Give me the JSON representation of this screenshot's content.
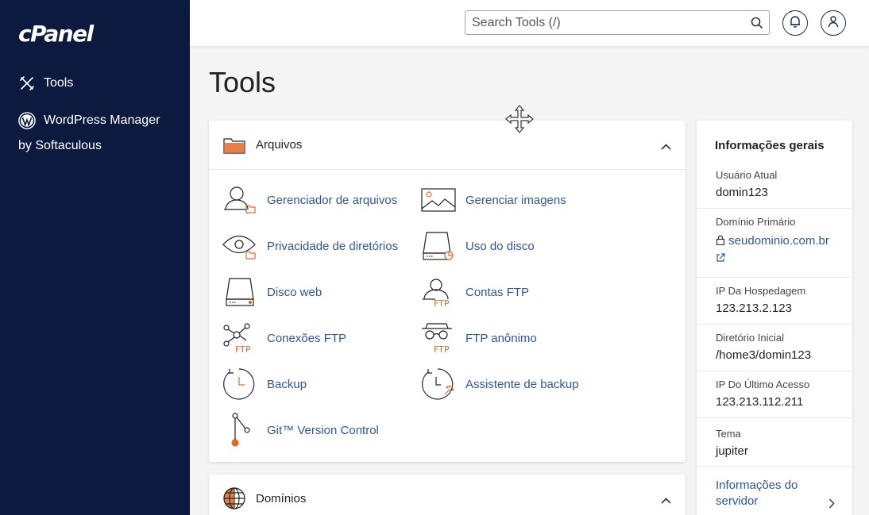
{
  "sidebar": {
    "logo": "cPanel",
    "items": [
      {
        "label": "Tools",
        "icon": "tools-icon"
      },
      {
        "label": "WordPress Manager",
        "label_line2": "by Softaculous",
        "icon": "wordpress-icon"
      }
    ]
  },
  "topbar": {
    "search_placeholder": "Search Tools (/)",
    "icons": [
      "search-icon",
      "bell-icon",
      "user-icon"
    ]
  },
  "main": {
    "title": "Tools",
    "sections": [
      {
        "title": "Arquivos",
        "tools": [
          {
            "label": "Gerenciador de arquivos",
            "icon": "file-manager-icon"
          },
          {
            "label": "Gerenciar imagens",
            "icon": "images-icon"
          },
          {
            "label": "Privacidade de diretórios",
            "icon": "directory-privacy-icon"
          },
          {
            "label": "Uso do disco",
            "icon": "disk-usage-icon"
          },
          {
            "label": "Disco web",
            "icon": "web-disk-icon"
          },
          {
            "label": "Contas FTP",
            "icon": "ftp-accounts-icon"
          },
          {
            "label": "Conexões FTP",
            "icon": "ftp-connections-icon"
          },
          {
            "label": "FTP anônimo",
            "icon": "anonymous-ftp-icon"
          },
          {
            "label": "Backup",
            "icon": "backup-icon"
          },
          {
            "label": "Assistente de backup",
            "icon": "backup-wizard-icon"
          },
          {
            "label": "Git™ Version Control",
            "icon": "git-icon"
          }
        ]
      },
      {
        "title": "Domínios"
      }
    ]
  },
  "info_panel": {
    "title": "Informações gerais",
    "rows": [
      {
        "label": "Usuário Atual",
        "value": "domin123"
      },
      {
        "label": "Domínio Primário",
        "value": "seudominio.com.br"
      },
      {
        "label": "IP Da Hospedagem",
        "value": "123.213.2.123"
      },
      {
        "label": "Diretório Inicial",
        "value": "/home3/domin123"
      },
      {
        "label": "IP Do Último Acesso",
        "value": "123.213.112.211"
      },
      {
        "label": "Tema",
        "value": "jupiter"
      }
    ],
    "more_link": "Informações do servidor"
  },
  "colors": {
    "sidebar_bg": "#0b1a3e",
    "link": "#2e5597",
    "accent_orange": "#e0692b"
  }
}
